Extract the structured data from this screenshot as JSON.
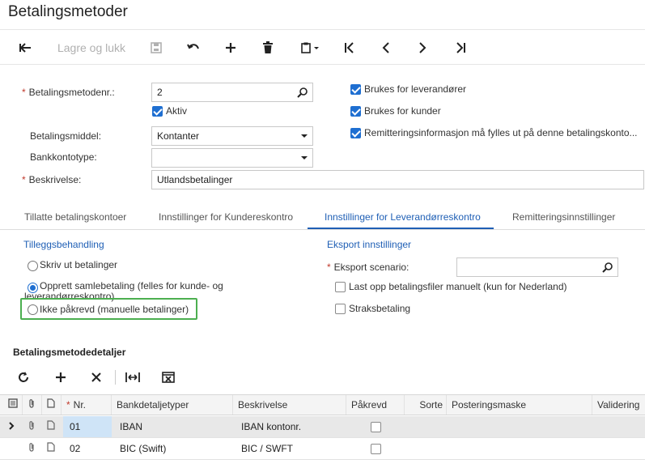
{
  "app": {
    "title": "Betalingsmetoder"
  },
  "toolbar": {
    "back_icon": "arrow-left-icon",
    "save_close_label": "Lagre og lukk",
    "save_icon": "save-icon",
    "undo_icon": "undo-icon",
    "add_icon": "plus-icon",
    "delete_icon": "trash-icon",
    "clipboard_icon": "clipboard-icon",
    "first_icon": "first-page-icon",
    "prev_icon": "chevron-left-icon",
    "next_icon": "chevron-right-icon",
    "last_icon": "last-page-icon"
  },
  "form": {
    "method_nr_label": "Betalingsmetodenr.:",
    "method_nr_value": "2",
    "active_label": "Aktiv",
    "active_checked": true,
    "payment_means_label": "Betalingsmiddel:",
    "payment_means_value": "Kontanter",
    "bank_account_type_label": "Bankkontotype:",
    "bank_account_type_value": "",
    "description_label": "Beskrivelse:",
    "description_value": "Utlandsbetalinger",
    "use_suppliers_label": "Brukes for leverandører",
    "use_customers_label": "Brukes for kunder",
    "remittance_label": "Remitteringsinformasjon må fylles ut på denne betalingskonto..."
  },
  "tabs": [
    {
      "label": "Tillatte betalingskontoer"
    },
    {
      "label": "Innstillinger for Kundereskontro"
    },
    {
      "label": "Innstillinger for Leverandørreskontro"
    },
    {
      "label": "Remitteringsinnstillinger"
    }
  ],
  "supplier_settings": {
    "additional_title": "Tilleggsbehandling",
    "print_payments_label": "Skriv ut betalinger",
    "create_batch_label": "Opprett samlebetaling (felles for kunde- og leverandørreskontro)",
    "not_required_label": "Ikke påkrevd (manuelle betalinger)",
    "export_title": "Eksport innstillinger",
    "export_scenario_label": "Eksport scenario:",
    "export_scenario_value": "",
    "upload_manual_label": "Last opp betalingsfiler manuelt (kun for Nederland)",
    "instant_payment_label": "Straksbetaling"
  },
  "details": {
    "title": "Betalingsmetodedetaljer",
    "columns": [
      "Nr.",
      "Bankdetaljetyper",
      "Beskrivelse",
      "Påkrevd",
      "Sorte",
      "Posteringsmaske",
      "Validering"
    ],
    "rows": [
      {
        "nr": "01",
        "type": "IBAN",
        "description": "IBAN kontonr."
      },
      {
        "nr": "02",
        "type": "BIC (Swift)",
        "description": "BIC / SWFT"
      }
    ]
  }
}
